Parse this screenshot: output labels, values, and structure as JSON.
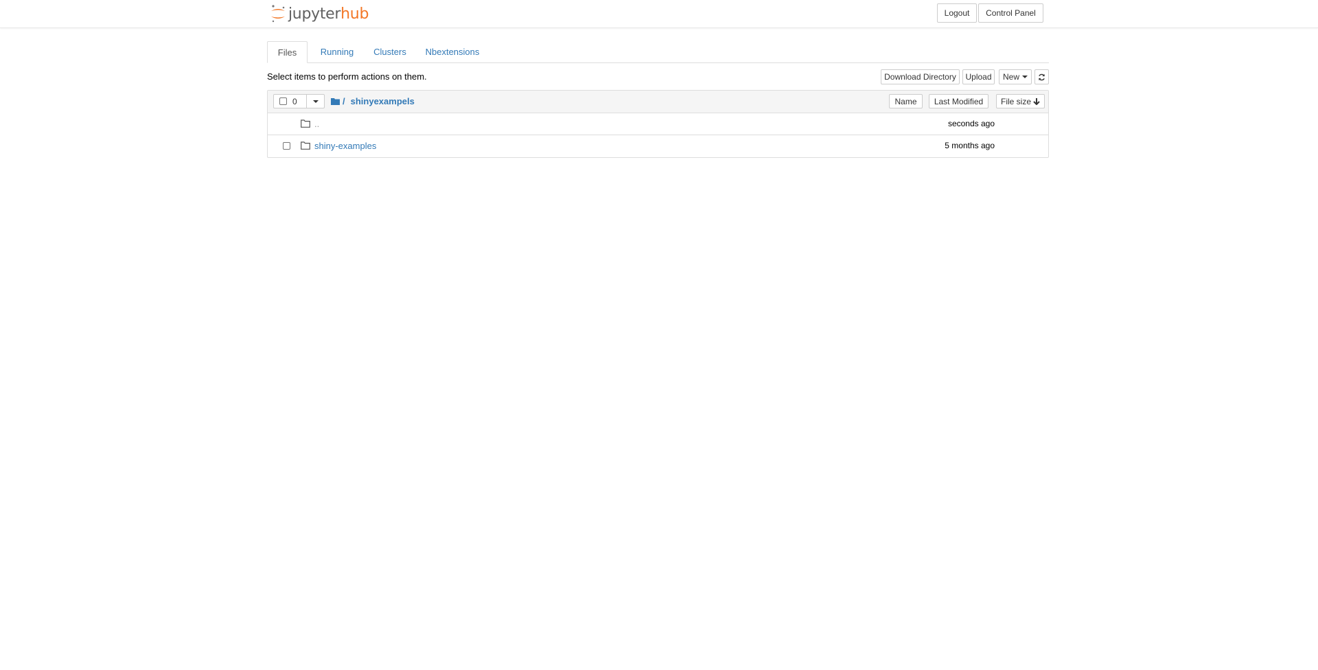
{
  "header": {
    "logo_text_left": "jupyter",
    "logo_text_right": "hub",
    "logout_label": "Logout",
    "control_panel_label": "Control Panel"
  },
  "tabs": [
    {
      "label": "Files",
      "active": true
    },
    {
      "label": "Running",
      "active": false
    },
    {
      "label": "Clusters",
      "active": false
    },
    {
      "label": "Nbextensions",
      "active": false
    }
  ],
  "toolbar": {
    "instructions": "Select items to perform actions on them.",
    "download_label": "Download Directory",
    "upload_label": "Upload",
    "new_label": "New"
  },
  "list": {
    "selected_count": "0",
    "breadcrumb_separator": "/",
    "current_dir": "shinyexampels",
    "sort_name_label": "Name",
    "sort_modified_label": "Last Modified",
    "sort_size_label": "File size",
    "rows": [
      {
        "name": "..",
        "modified": "seconds ago",
        "has_checkbox": false
      },
      {
        "name": "shiny-examples",
        "modified": "5 months ago",
        "has_checkbox": true
      }
    ]
  },
  "colors": {
    "brand_orange": "#f37726",
    "link_blue": "#337ab7"
  }
}
